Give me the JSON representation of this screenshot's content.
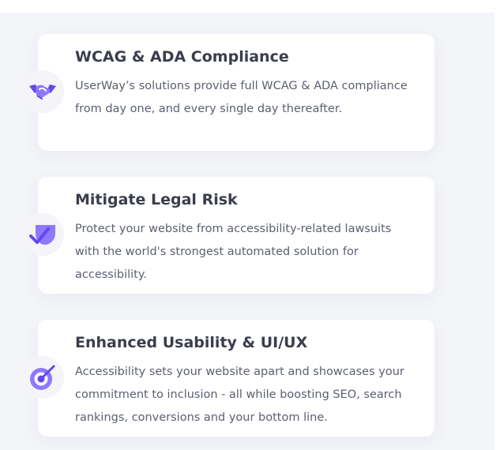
{
  "features": [
    {
      "icon": "handshake-icon",
      "title": "WCAG & ADA Compliance",
      "text": "UserWay’s solutions provide full WCAG & ADA compliance from day one, and every single day thereafter."
    },
    {
      "icon": "shield-check-icon",
      "title": "Mitigate Legal Risk",
      "text": "Protect your website from accessibility-related lawsuits with the world's strongest automated solution for accessibility."
    },
    {
      "icon": "target-icon",
      "title": "Enhanced Usability & UI/UX",
      "text": "Accessibility sets your website apart and showcases your commitment to inclusion - all while boosting SEO, search rankings, conversions and your bottom line."
    }
  ],
  "colors": {
    "icon_primary": "#6446f2",
    "icon_secondary": "#8e78ff",
    "background": "#f4f5f9",
    "card": "#ffffff"
  }
}
